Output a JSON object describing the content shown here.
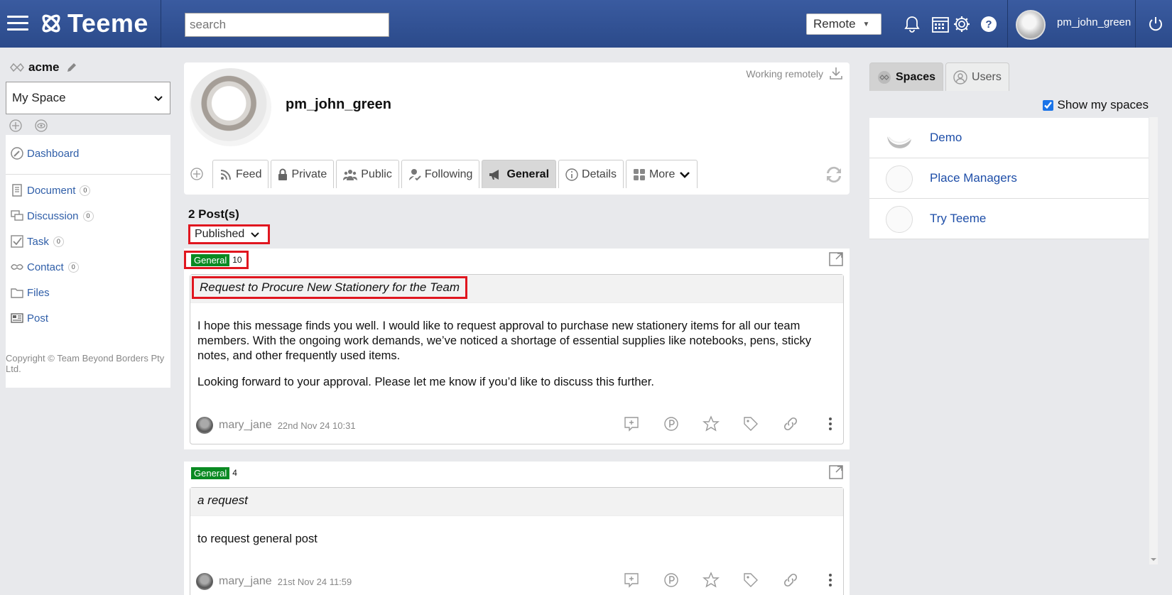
{
  "header": {
    "app_name": "Teeme",
    "search_placeholder": "search",
    "status_value": "Remote",
    "username": "pm_john_green"
  },
  "sidebar": {
    "org_name": "acme",
    "space_select": "My Space",
    "items": [
      {
        "label": "Dashboard",
        "icon": "dashboard-icon"
      },
      {
        "label": "Document",
        "count": "0",
        "icon": "document-icon"
      },
      {
        "label": "Discussion",
        "count": "0",
        "icon": "discussion-icon"
      },
      {
        "label": "Task",
        "count": "0",
        "icon": "task-icon"
      },
      {
        "label": "Contact",
        "count": "0",
        "icon": "contact-icon"
      },
      {
        "label": "Files",
        "icon": "folder-icon"
      },
      {
        "label": "Post",
        "icon": "post-icon"
      }
    ],
    "copyright": "Copyright © Team Beyond Borders Pty Ltd."
  },
  "profile": {
    "name": "pm_john_green",
    "working_status": "Working remotely",
    "tabs": [
      {
        "label": "Feed",
        "icon": "rss-icon"
      },
      {
        "label": "Private",
        "icon": "lock-icon"
      },
      {
        "label": "Public",
        "icon": "people-icon"
      },
      {
        "label": "Following",
        "icon": "follow-icon"
      },
      {
        "label": "General",
        "icon": "megaphone-icon",
        "active": true
      },
      {
        "label": "Details",
        "icon": "info-icon"
      },
      {
        "label": "More",
        "icon": "grid-icon"
      }
    ]
  },
  "posts_header": {
    "count_label": "2 Post(s)",
    "filter_value": "Published"
  },
  "posts": [
    {
      "category": "General",
      "count": "10",
      "title": "Request to Procure New Stationery for the Team",
      "body": [
        "I hope this message finds you well. I would like to request approval to purchase new stationery items for all our team members. With the ongoing work demands, we’ve noticed a shortage of essential supplies like notebooks, pens, sticky notes, and other frequently used items.",
        "Looking forward to your approval. Please let me know if you’d like to discuss this further."
      ],
      "author": "mary_jane",
      "date": "22nd Nov 24 10:31"
    },
    {
      "category": "General",
      "count": "4",
      "title": "a request",
      "body": [
        "to request general post"
      ],
      "author": "mary_jane",
      "date": "21st Nov 24 11:59"
    }
  ],
  "right": {
    "tabs": [
      {
        "label": "Spaces",
        "active": true
      },
      {
        "label": "Users"
      }
    ],
    "show_my_spaces": "Show my spaces",
    "spaces": [
      {
        "name": "Demo"
      },
      {
        "name": "Place Managers"
      },
      {
        "name": "Try Teeme"
      }
    ]
  },
  "colors": {
    "header_bg": "#2f4f93",
    "link": "#2f5ea8",
    "category_badge": "#0a8a22",
    "highlight": "#e0161f"
  }
}
